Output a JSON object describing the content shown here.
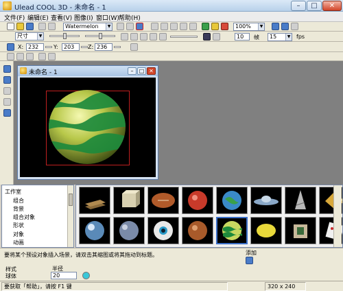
{
  "window": {
    "title": "Ulead COOL 3D - 未命名 - 1",
    "controls": {
      "minimize": "–",
      "maximize": "□",
      "close": "✕"
    }
  },
  "menu": [
    "文件(F)",
    "编辑(E)",
    "查看(V)",
    "图像(I)",
    "窗口(W)",
    "帮助(H)"
  ],
  "toolbar": {
    "object_combo": "Watermelon",
    "zoom_combo": "100%",
    "frame_value": "10",
    "axis_label": "帧",
    "fps_value": "15",
    "fps_label": "fps",
    "size_label": "尺寸"
  },
  "coords": {
    "x_label": "X:",
    "x_value": "232",
    "y_label": "Y:",
    "y_value": "203",
    "z_label": "Z:",
    "z_value": "236"
  },
  "document": {
    "title": "未命名 - 1"
  },
  "tree": {
    "items": [
      "工作室",
      "组合",
      "背景",
      "组合对象",
      "形状",
      "对象",
      "动画"
    ]
  },
  "thumbnails": [
    {
      "name": "slab-thumb"
    },
    {
      "name": "box-thumb"
    },
    {
      "name": "rugby-thumb"
    },
    {
      "name": "red-sphere-thumb"
    },
    {
      "name": "earth-thumb"
    },
    {
      "name": "ufo-thumb"
    },
    {
      "name": "drill-thumb"
    },
    {
      "name": "gem-thumb"
    },
    {
      "name": "glass-sphere-thumb"
    },
    {
      "name": "planet-thumb"
    },
    {
      "name": "eyeball-thumb"
    },
    {
      "name": "brown-sphere-thumb"
    },
    {
      "name": "watermelon-thumb",
      "selected": true
    },
    {
      "name": "lemon-thumb"
    },
    {
      "name": "d-cube-thumb"
    },
    {
      "name": "dice-thumb"
    }
  ],
  "hint": {
    "text": "要将某个预设对象插入场景，请双击其缩图或将其拖动到标题。",
    "add_label": "添加"
  },
  "props": {
    "style_label": "样式",
    "sphere_label": "球体",
    "radius_label": "半径",
    "radius_value": "20"
  },
  "status": {
    "help_text": "要获取「帮助」，请按 F1 键",
    "size_text": "320 x 240"
  },
  "colors": {
    "selection_rect": "#c02020",
    "melon_light": "#d8e070",
    "melon_dark": "#1a8a3a"
  }
}
